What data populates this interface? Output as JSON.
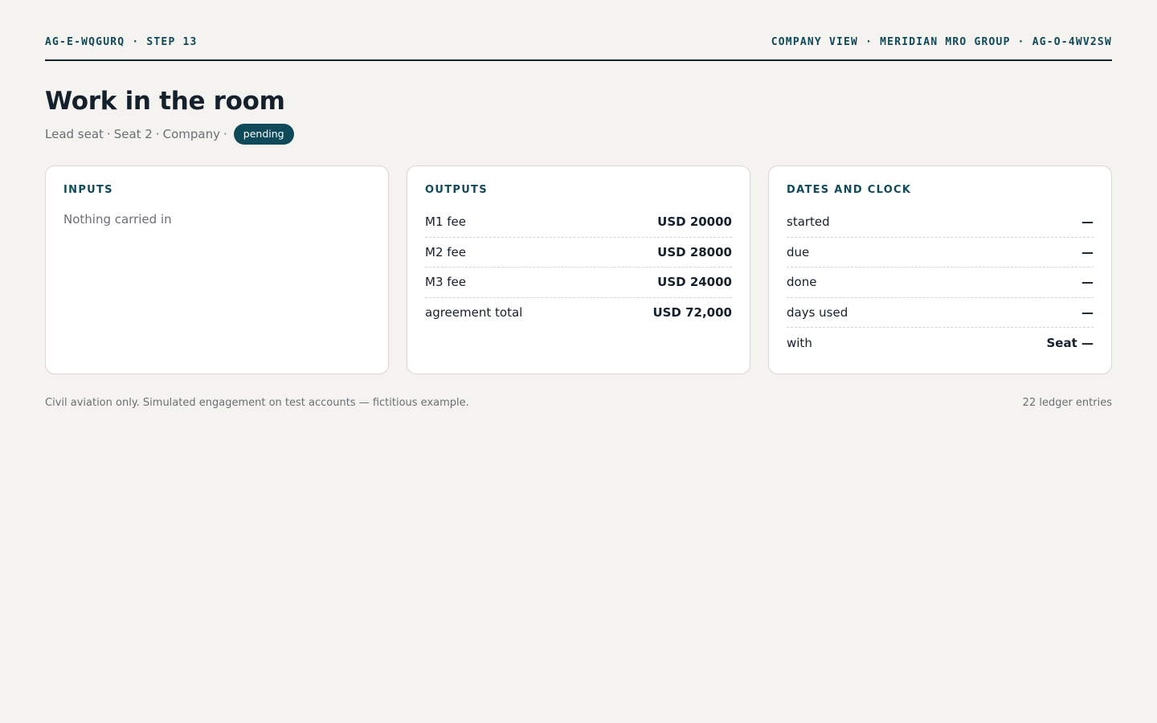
{
  "header": {
    "left": "AG-E-WQGURQ · STEP 13",
    "right": "COMPANY VIEW · MERIDIAN MRO GROUP · AG-O-4WV2SW"
  },
  "title": "Work in the room",
  "subtitle": {
    "parts": [
      "Lead seat",
      "Seat 2",
      "Company"
    ],
    "separator": "·",
    "status": "pending"
  },
  "cards": {
    "inputs": {
      "heading": "INPUTS",
      "empty_text": "Nothing carried in"
    },
    "outputs": {
      "heading": "OUTPUTS",
      "rows": [
        {
          "label": "M1 fee",
          "value": "USD 20000"
        },
        {
          "label": "M2 fee",
          "value": "USD 28000"
        },
        {
          "label": "M3 fee",
          "value": "USD 24000"
        },
        {
          "label": "agreement total",
          "value": "USD 72,000"
        }
      ]
    },
    "dates": {
      "heading": "DATES AND CLOCK",
      "rows": [
        {
          "label": "started",
          "value": "—"
        },
        {
          "label": "due",
          "value": "—"
        },
        {
          "label": "done",
          "value": "—"
        },
        {
          "label": "days used",
          "value": "—"
        },
        {
          "label": "with",
          "value": "Seat —"
        }
      ]
    }
  },
  "footer": {
    "note": "Civil aviation only. Simulated engagement on test accounts — fictitious example.",
    "count": "22 ledger entries"
  },
  "colors": {
    "background": "#f4f3ef",
    "accent": "#0f4a5a",
    "text": "#14202b",
    "muted": "#6a6f75"
  }
}
